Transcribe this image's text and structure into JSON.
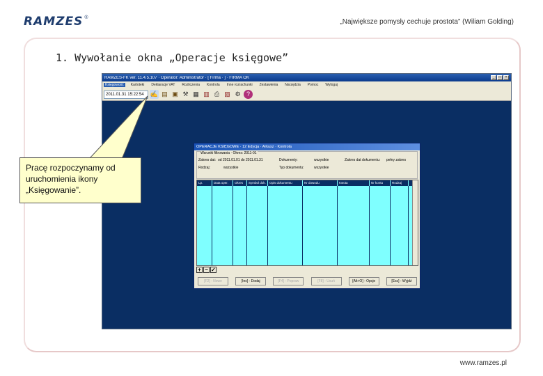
{
  "header": {
    "logo": "RAMZES",
    "logo_mark": "®",
    "quote": "„Największe pomysły cechuje prostota” (Wiliam Golding)"
  },
  "slide": {
    "title": "1. Wywołanie okna „Operacje księgowe”"
  },
  "callout": {
    "lines": [
      "Pracę rozpoczynamy od",
      "uruchomienia ikony",
      "„Księgowanie”."
    ]
  },
  "footer": {
    "url": "www.ramzes.pl"
  },
  "app": {
    "title": "RAMZES-FK ver. 11.4.5.107 · Operator: Administrator · [ Firma · ] · FIRMA OK",
    "window_controls": [
      "_",
      "□",
      "×"
    ],
    "menu": [
      "Księgowość",
      "Kartoteki",
      "Deklaracje VAT",
      "Rozliczenia",
      "Kontrola",
      "Inne rozrachunki",
      "Zestawienia",
      "Narzędzia",
      "Pomoc",
      "Wyloguj"
    ],
    "datetime": "2011.01.31 15:22:54",
    "toolbar_icons": [
      "ksiegowanie-icon",
      "folder-icon",
      "folder-open-icon",
      "tools-icon",
      "calculator-icon",
      "table-icon",
      "printer-icon",
      "archive-icon",
      "connect-icon",
      "help-icon"
    ],
    "toolbar_glyphs": [
      "✍",
      "▤",
      "▣",
      "⚒",
      "▦",
      "▥",
      "⎙",
      "▧",
      "⚙",
      "?"
    ],
    "dialog": {
      "title": "OPERACJE KSIĘGOWE · 12 Edycja · Arkusz · Kontrola",
      "group_label": "Warunki filtrowania · Okres: 2011-01",
      "fields": [
        {
          "label": "Zakres dat:",
          "value": "od 2011.01.01 do 2011.01.31"
        },
        {
          "label": "Dokumenty:",
          "value": "wszystkie"
        },
        {
          "label": "Zakres dat dokumentu:",
          "value": "pełny zakres"
        },
        {
          "label": "Rodzaj:",
          "value": "wszystkie"
        },
        {
          "label": "Typ dokumentu:",
          "value": "wszystkie"
        }
      ],
      "columns": [
        "Lp.",
        "Data oper.",
        "Okres",
        "Symbol dok.",
        "Opis dokumentu",
        "Nr dowodu",
        "Kwota",
        "Nr konta",
        "Rodzaj"
      ],
      "nav_buttons": [
        "+",
        "−",
        "✓"
      ],
      "buttons": [
        {
          "label": "[F2] - Nowe",
          "disabled": true
        },
        {
          "label": "[Ins] - Dodaj",
          "disabled": false
        },
        {
          "label": "[F4] - Popraw",
          "disabled": true
        },
        {
          "label": "[F8] - Usuń",
          "disabled": true
        },
        {
          "label": "[Alt+O] - Opcje",
          "disabled": false
        },
        {
          "label": "[Esc] - Wyjdź",
          "disabled": false
        }
      ]
    }
  }
}
